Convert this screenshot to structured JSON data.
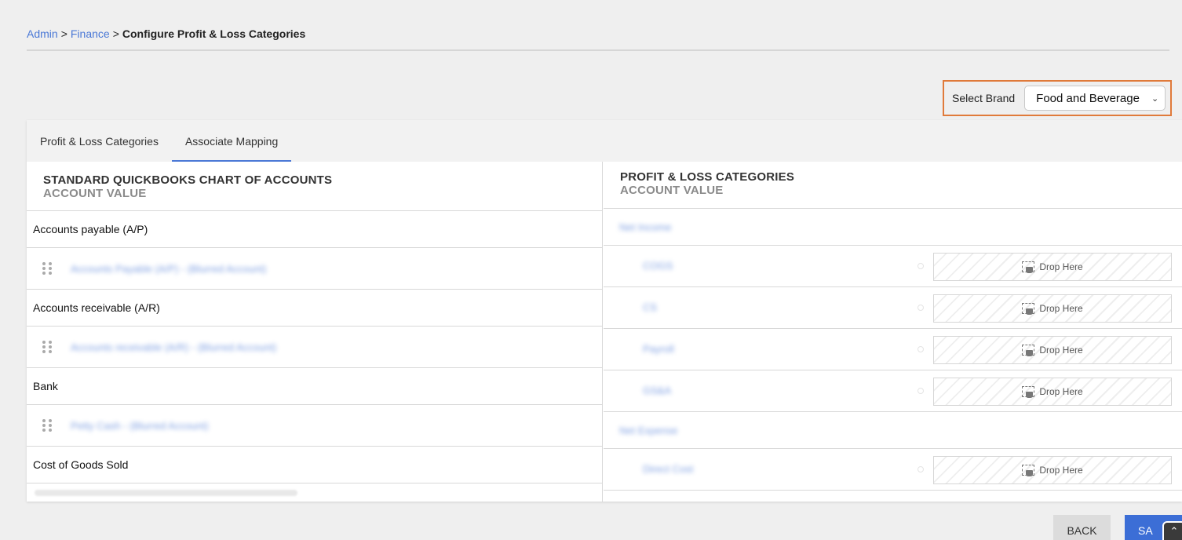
{
  "breadcrumb": {
    "items": [
      "Admin",
      "Finance"
    ],
    "separator": ">",
    "current": "Configure Profit & Loss Categories"
  },
  "brand": {
    "label": "Select Brand",
    "selected": "Food and Beverage",
    "chevron_icon": "chevron-down-icon"
  },
  "tabs": [
    {
      "label": "Profit & Loss Categories",
      "active": false
    },
    {
      "label": "Associate Mapping",
      "active": true
    }
  ],
  "left": {
    "title": "STANDARD QUICKBOOKS CHART OF ACCOUNTS",
    "subtitle": "ACCOUNT VALUE",
    "groups": [
      {
        "name": "Accounts payable (A/P)",
        "item": "Accounts Payable (A/P) - (Blurred Account)"
      },
      {
        "name": "Accounts receivable (A/R)",
        "item": "Accounts receivable (A/R) - (Blurred Account)"
      },
      {
        "name": "Bank",
        "item": "Petty Cash - (Blurred Account)"
      },
      {
        "name": "Cost of Goods Sold",
        "item": ""
      }
    ]
  },
  "right": {
    "title": "PROFIT & LOSS CATEGORIES",
    "subtitle": "ACCOUNT VALUE",
    "drop_label": "Drop Here",
    "groups": [
      {
        "name": "Net Income",
        "items": [
          "COGS",
          "CS",
          "Payroll",
          "GS&A"
        ]
      },
      {
        "name": "Net Expense",
        "items": [
          "Direct Cost"
        ]
      }
    ]
  },
  "actions": {
    "back": "BACK",
    "save": "SA"
  }
}
